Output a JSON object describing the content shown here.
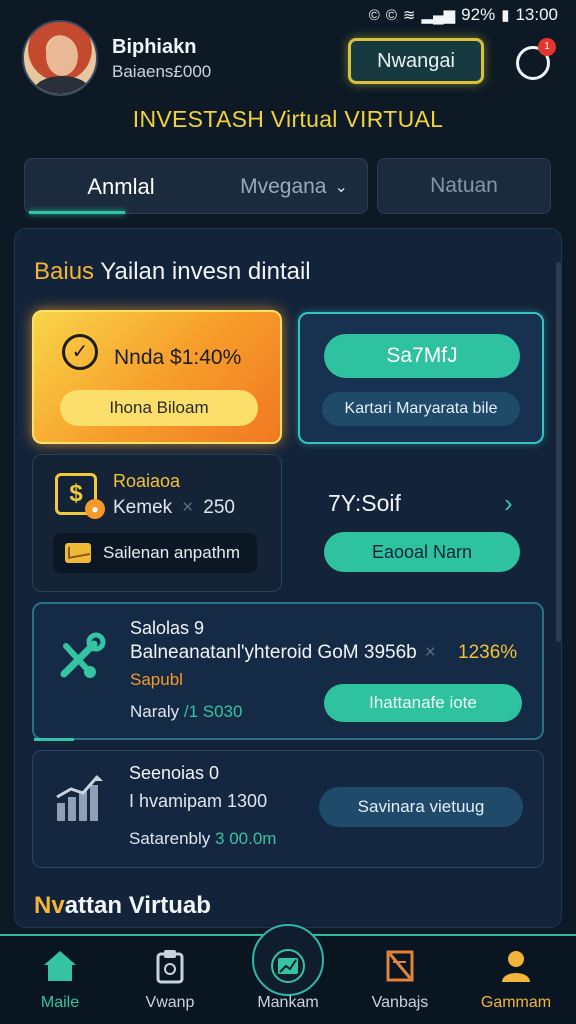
{
  "status_bar": {
    "icons": [
      "circle-icon",
      "circle-icon",
      "wifi-icon",
      "signal-icon"
    ],
    "battery": "92%",
    "time": "13:00"
  },
  "header": {
    "user_name": "Biphiakn",
    "user_balance": "Baiaens£000",
    "badge_label": "Nwangai",
    "notification_count": "1"
  },
  "page_title": "INVESTASH Virtual VIRTUAL",
  "tabs": {
    "active": "Anmlal",
    "dropdown": "Mvegana",
    "other": "Natuan"
  },
  "section": {
    "title_accent": "Baius",
    "title_rest": " Yailan invesn dintail"
  },
  "card_orange": {
    "text": "Nnda $1:40%",
    "button": "Ihona Biloam"
  },
  "card_teal": {
    "pill": "Sa7MfJ",
    "sub": "Kartari Maryarata bile"
  },
  "card_dark": {
    "title": "Roaiaoa",
    "label": "Kemek",
    "value": "250",
    "pill": "Sailenan anpathm"
  },
  "sort": {
    "label": "7Y:Soif",
    "button": "Eaooal Narn"
  },
  "card_wide": {
    "title": "Salolas 9",
    "line": "Balneanatanl'yhteroid GoM 3956b",
    "percent": "1236%",
    "sub": "Sapubl",
    "amount_label": "Naraly",
    "amount_value": "/1 S030",
    "button": "Ihattanafe iote"
  },
  "card_wide2": {
    "title": "Seenoias 0",
    "line": "I hvamipam 1300",
    "amount_label": "Satarenbly",
    "amount_value": "3 00.0m",
    "button": "Savinara vietuug"
  },
  "footer": {
    "title_accent": "Nv",
    "title_rest": "attan Virtuab"
  },
  "bottom_nav": [
    {
      "label": "Maile",
      "icon": "home-icon"
    },
    {
      "label": "Vwanp",
      "icon": "clipboard-icon"
    },
    {
      "label": "Mankam",
      "icon": "chart-icon"
    },
    {
      "label": "Vanbajs",
      "icon": "document-icon"
    },
    {
      "label": "Gammam",
      "icon": "user-icon"
    }
  ],
  "colors": {
    "accent_teal": "#2fc29f",
    "accent_yellow": "#f3b43a",
    "background": "#0d1a26",
    "card_orange": "#f7a02c"
  }
}
